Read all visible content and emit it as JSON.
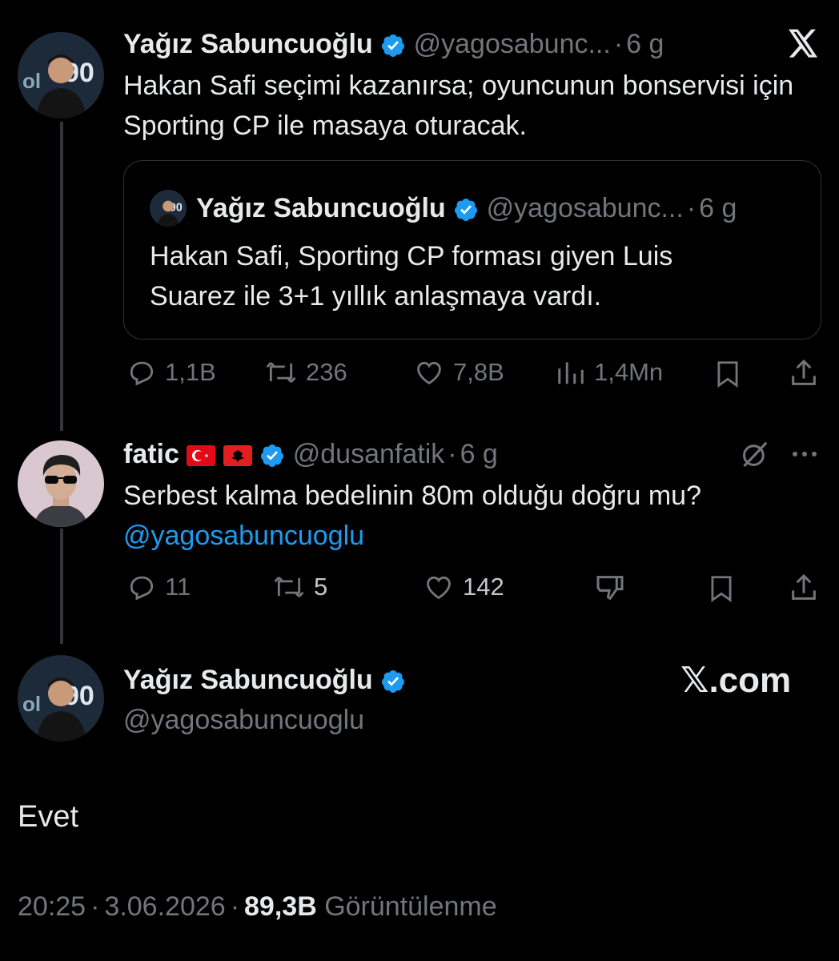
{
  "colors": {
    "background": "#000000",
    "text": "#e7e9ea",
    "muted": "#71767b",
    "verified": "#1d9bf0",
    "link": "#1d9bf0",
    "border": "#2f3336"
  },
  "tweet1": {
    "name": "Yağız Sabuncuoğlu",
    "handle": "@yagosabunc...",
    "sep": "·",
    "time": "6 g",
    "text": "Hakan Safi seçimi kazanırsa; oyuncunun bonservisi için Sporting CP ile masaya oturacak.",
    "quote": {
      "name": "Yağız Sabuncuoğlu",
      "handle": "@yagosabunc...",
      "sep": "·",
      "time": "6 g",
      "text": "Hakan Safi, Sporting CP forması giyen Luis Suarez ile 3+1 yıllık anlaşmaya vardı."
    },
    "actions": {
      "replies": "1,1B",
      "reposts": "236",
      "likes": "7,8B",
      "views": "1,4Mn"
    },
    "icons": [
      "x-logo-icon",
      "reply-icon",
      "repost-icon",
      "like-icon",
      "views-icon",
      "bookmark-icon",
      "share-icon"
    ]
  },
  "tweet2": {
    "name": "fatic",
    "flags": [
      "turkey-flag-icon",
      "albania-flag-icon"
    ],
    "handle": "@dusanfatik",
    "sep": "·",
    "time": "6 g",
    "text": "Serbest kalma bedelinin 80m olduğu doğru mu?",
    "mention": "@yagosabuncuoglu",
    "actions": {
      "replies": "11",
      "reposts": "5",
      "likes": "142"
    },
    "icons": [
      "grok-icon",
      "more-icon",
      "reply-icon",
      "repost-icon",
      "like-icon",
      "dislike-icon",
      "bookmark-icon",
      "share-icon"
    ]
  },
  "tweet3": {
    "name": "Yağız Sabuncuoğlu",
    "handle": "@yagosabuncuoglu",
    "brand": "𝕏.com",
    "text": "Evet",
    "time": "20:25",
    "sep1": "·",
    "date": "3.06.2026",
    "sep2": "·",
    "views": "89,3B",
    "views_label": "Görüntülenme"
  }
}
